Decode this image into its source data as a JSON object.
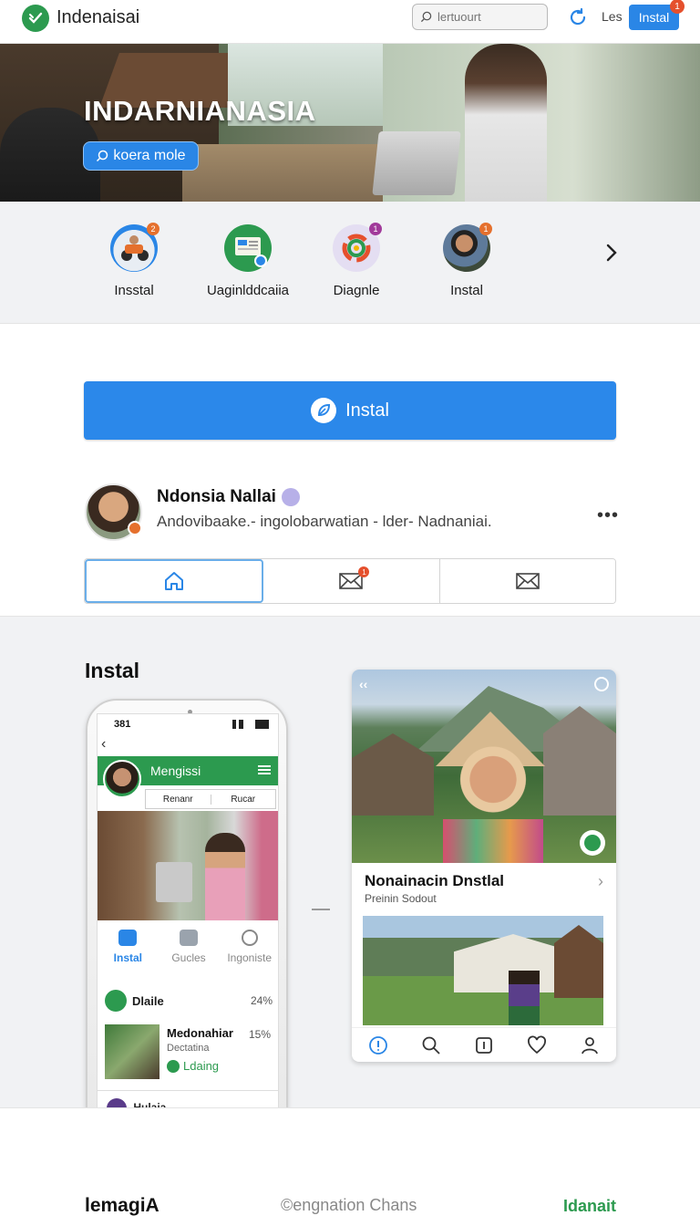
{
  "topbar": {
    "brand": "Indenaisai",
    "search_placeholder": "lertuourt",
    "les": "Les",
    "install": "Instal",
    "install_badge": "1"
  },
  "hero": {
    "title": "INDARNIANASIA",
    "button": "koera mole"
  },
  "categories": [
    {
      "label": "Insstal",
      "badge": "2",
      "badge_color": "#e5702d"
    },
    {
      "label": "Uaginlddcaiia",
      "badge": "",
      "badge_color": "#2a86e6"
    },
    {
      "label": "Diagnle",
      "badge": "1",
      "badge_color": "#a13a9a"
    },
    {
      "label": "Instal",
      "badge": "1",
      "badge_color": "#e5702d"
    }
  ],
  "card": {
    "install_button": "Instal",
    "profile_name": "Ndonsia Nallai",
    "profile_sub": "Andovibaake.- ingolobarwatian - lder- Nadnaniai.",
    "tab_badge": "1"
  },
  "section": {
    "title": "Instal"
  },
  "phone": {
    "time": "381",
    "header": "Mengissi",
    "row_left": "Renanr",
    "row_right": "Rucar",
    "tabs": [
      "Instal",
      "Gucles",
      "Ingoniste"
    ],
    "item_label": "Dlaile",
    "item_pct": "24%",
    "card_title": "Medonahiar",
    "card_sub": "Dectatina",
    "card_status": "Ldaing",
    "card_pct": "15%",
    "bottom_label": "Hulaia"
  },
  "post_card": {
    "title": "Nonainacin Dnstlal",
    "subtitle": "Preinin Sodout"
  },
  "footer": {
    "left": "lemagiA",
    "center": "©engnation Chans",
    "right": "Idanait"
  },
  "colors": {
    "accent": "#2a86e6",
    "brand_green": "#2c9a4f",
    "badge": "#e5502d"
  }
}
